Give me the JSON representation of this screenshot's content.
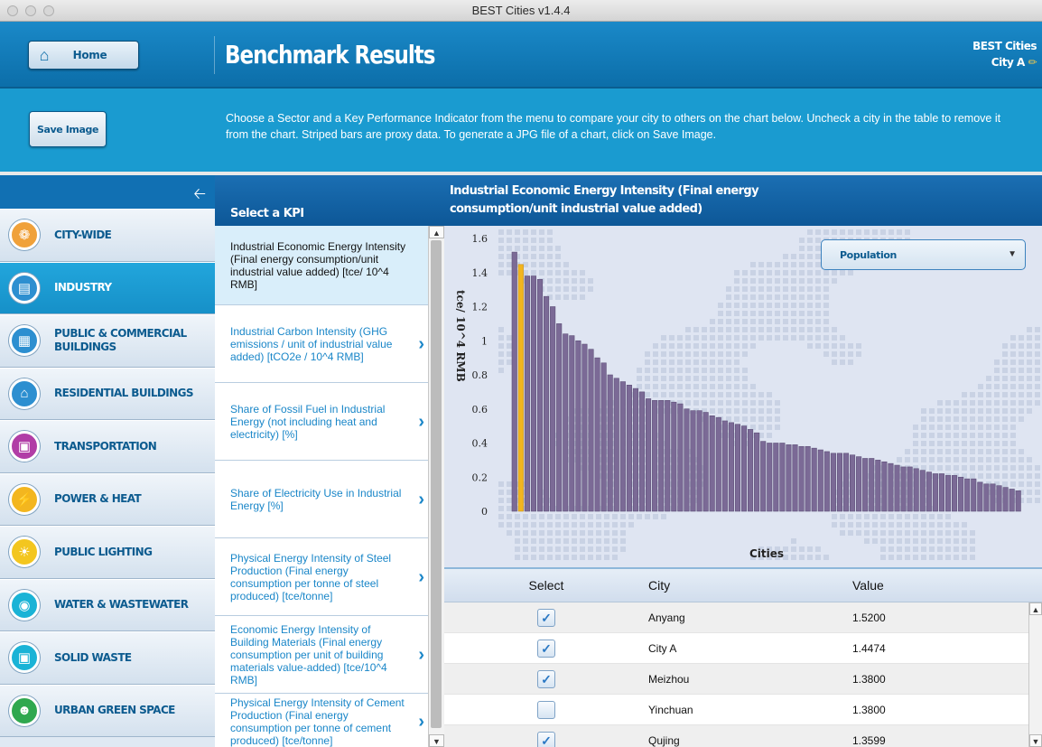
{
  "window": {
    "title": "BEST Cities v1.4.4"
  },
  "header": {
    "home_label": "Home",
    "title": "Benchmark Results",
    "brand": "BEST Cities",
    "city": "City A"
  },
  "band": {
    "save_label": "Save Image",
    "instructions": "Choose a Sector and a Key Performance Indicator from the menu to compare your city to others on the chart below. Uncheck a city in the table to remove it from the chart. Striped bars are proxy data. To generate a JPG file of a chart, click on Save Image."
  },
  "sidebar": {
    "items": [
      {
        "label": "CITY-WIDE",
        "icon": "city-wide-icon",
        "color": "#f0a13a"
      },
      {
        "label": "INDUSTRY",
        "icon": "industry-icon",
        "color": "#2d8fd0"
      },
      {
        "label": "PUBLIC & COMMERCIAL BUILDINGS",
        "icon": "commercial-buildings-icon",
        "color": "#2d8fd0"
      },
      {
        "label": "RESIDENTIAL BUILDINGS",
        "icon": "residential-buildings-icon",
        "color": "#2d8fd0"
      },
      {
        "label": "TRANSPORTATION",
        "icon": "transportation-icon",
        "color": "#b13da6"
      },
      {
        "label": "POWER & HEAT",
        "icon": "power-heat-icon",
        "color": "#f3b61f"
      },
      {
        "label": "PUBLIC LIGHTING",
        "icon": "lightbulb-icon",
        "color": "#f3c61f"
      },
      {
        "label": "WATER & WASTEWATER",
        "icon": "water-drop-icon",
        "color": "#1ab3d6"
      },
      {
        "label": "SOLID WASTE",
        "icon": "solid-waste-icon",
        "color": "#1ab3d6"
      },
      {
        "label": "URBAN GREEN SPACE",
        "icon": "green-space-icon",
        "color": "#2fa84f"
      }
    ]
  },
  "kpi": {
    "heading": "Select a KPI",
    "items": [
      "Industrial Economic Energy Intensity (Final energy consumption/unit industrial value added) [tce/ 10^4 RMB]",
      "Industrial Carbon Intensity (GHG emissions / unit of industrial value added) [tCO2e / 10^4 RMB]",
      "Share of Fossil Fuel in Industrial Energy (not including heat and electricity) [%]",
      "Share of Electricity Use in Industrial Energy [%]",
      "Physical Energy Intensity of Steel Production (Final energy consumption per tonne of steel produced) [tce/tonne]",
      "Economic Energy Intensity of Building Materials (Final energy consumption per unit of building materials value-added) [tce/10^4 RMB]",
      "Physical Energy Intensity of Cement Production (Final energy consumption per tonne of cement produced) [tce/tonne]"
    ]
  },
  "chart": {
    "title": "Industrial Economic Energy Intensity (Final energy consumption/unit industrial value added)",
    "dropdown": "Population"
  },
  "chart_data": {
    "type": "bar",
    "ylabel": "tce/ 10^4 RMB",
    "xlabel": "Cities",
    "ylim": [
      0,
      1.6
    ],
    "yticks": [
      0,
      0.2,
      0.4,
      0.6,
      0.8,
      1,
      1.2,
      1.4,
      1.6
    ],
    "highlight_index": 1,
    "highlight_color": "#f2b51e",
    "bar_color": "#7b6a96",
    "values": [
      1.52,
      1.4474,
      1.38,
      1.38,
      1.3599,
      1.26,
      1.2,
      1.1,
      1.04,
      1.03,
      1.0,
      0.98,
      0.95,
      0.9,
      0.87,
      0.8,
      0.78,
      0.76,
      0.74,
      0.72,
      0.7,
      0.66,
      0.65,
      0.65,
      0.65,
      0.64,
      0.63,
      0.6,
      0.59,
      0.59,
      0.58,
      0.56,
      0.55,
      0.53,
      0.52,
      0.51,
      0.5,
      0.48,
      0.46,
      0.41,
      0.4,
      0.4,
      0.4,
      0.39,
      0.39,
      0.38,
      0.38,
      0.37,
      0.36,
      0.35,
      0.34,
      0.34,
      0.34,
      0.33,
      0.32,
      0.31,
      0.31,
      0.3,
      0.29,
      0.28,
      0.27,
      0.26,
      0.26,
      0.25,
      0.24,
      0.23,
      0.22,
      0.22,
      0.21,
      0.21,
      0.2,
      0.19,
      0.19,
      0.17,
      0.16,
      0.16,
      0.15,
      0.14,
      0.13,
      0.12
    ]
  },
  "table": {
    "headers": {
      "select": "Select",
      "city": "City",
      "value": "Value"
    },
    "rows": [
      {
        "city": "Anyang",
        "value": "1.5200",
        "checked": true
      },
      {
        "city": "City A",
        "value": "1.4474",
        "checked": true
      },
      {
        "city": "Meizhou",
        "value": "1.3800",
        "checked": true
      },
      {
        "city": "Yinchuan",
        "value": "1.3800",
        "checked": false
      },
      {
        "city": "Qujing",
        "value": "1.3599",
        "checked": true
      }
    ]
  }
}
